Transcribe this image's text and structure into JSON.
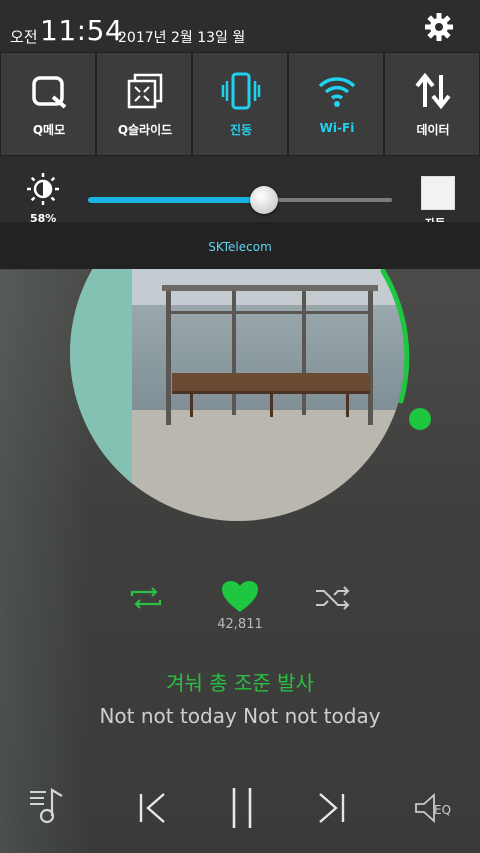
{
  "status": {
    "ampm": "오전",
    "time": "11:54",
    "date": "2017년 2월 13일 월"
  },
  "quick_settings": [
    {
      "label": "Q메모",
      "icon": "qmemo-icon",
      "active": false
    },
    {
      "label": "Q슬라이드",
      "icon": "qslide-icon",
      "active": false
    },
    {
      "label": "진동",
      "icon": "vibrate-icon",
      "active": true
    },
    {
      "label": "Wi-Fi",
      "icon": "wifi-icon",
      "active": true
    },
    {
      "label": "데이터",
      "icon": "data-icon",
      "active": false
    }
  ],
  "brightness": {
    "percent_label": "58%",
    "level": 0.58,
    "auto_label": "자동"
  },
  "carrier": "SKTelecom",
  "player": {
    "likes": "42,811",
    "lyric_current": "겨눠 총 조준 발사",
    "lyric_next": "Not not today Not not today",
    "accent": "#1fc640"
  }
}
